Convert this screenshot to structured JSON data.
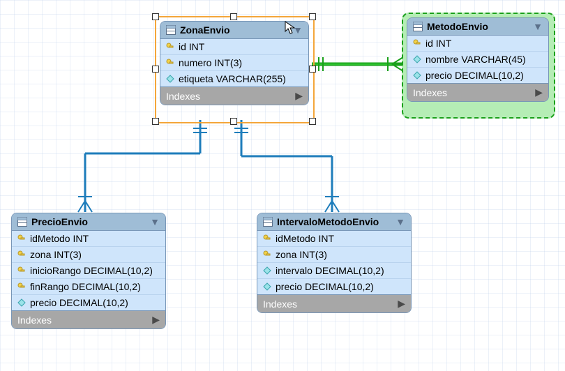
{
  "indexes_label": "Indexes",
  "entities": {
    "zonaEnvio": {
      "name": "ZonaEnvio",
      "cols": [
        {
          "text": "id INT",
          "icon": "key"
        },
        {
          "text": "numero INT(3)",
          "icon": "key"
        },
        {
          "text": "etiqueta VARCHAR(255)",
          "icon": "diamond"
        }
      ]
    },
    "metodoEnvio": {
      "name": "MetodoEnvio",
      "cols": [
        {
          "text": "id INT",
          "icon": "key"
        },
        {
          "text": "nombre VARCHAR(45)",
          "icon": "diamond"
        },
        {
          "text": "precio DECIMAL(10,2)",
          "icon": "diamond"
        }
      ]
    },
    "precioEnvio": {
      "name": "PrecioEnvio",
      "cols": [
        {
          "text": "idMetodo INT",
          "icon": "key"
        },
        {
          "text": "zona INT(3)",
          "icon": "key"
        },
        {
          "text": "inicioRango DECIMAL(10,2)",
          "icon": "key"
        },
        {
          "text": "finRango DECIMAL(10,2)",
          "icon": "key"
        },
        {
          "text": "precio DECIMAL(10,2)",
          "icon": "diamond"
        }
      ]
    },
    "intervaloMetodoEnvio": {
      "name": "IntervaloMetodoEnvio",
      "cols": [
        {
          "text": "idMetodo INT",
          "icon": "key"
        },
        {
          "text": "zona INT(3)",
          "icon": "key"
        },
        {
          "text": "intervalo DECIMAL(10,2)",
          "icon": "diamond"
        },
        {
          "text": "precio DECIMAL(10,2)",
          "icon": "diamond"
        }
      ]
    }
  },
  "chart_data": {
    "type": "table",
    "description": "Entity-Relationship diagram (MySQL Workbench style) with four tables and three relationships.",
    "tables": [
      {
        "name": "ZonaEnvio",
        "columns": [
          "id INT (PK)",
          "numero INT(3) (PK)",
          "etiqueta VARCHAR(255)"
        ]
      },
      {
        "name": "MetodoEnvio",
        "columns": [
          "id INT (PK)",
          "nombre VARCHAR(45)",
          "precio DECIMAL(10,2)"
        ]
      },
      {
        "name": "PrecioEnvio",
        "columns": [
          "idMetodo INT (PK)",
          "zona INT(3) (PK)",
          "inicioRango DECIMAL(10,2) (PK)",
          "finRango DECIMAL(10,2) (PK)",
          "precio DECIMAL(10,2)"
        ]
      },
      {
        "name": "IntervaloMetodoEnvio",
        "columns": [
          "idMetodo INT (PK)",
          "zona INT(3) (PK)",
          "intervalo DECIMAL(10,2)",
          "precio DECIMAL(10,2)"
        ]
      }
    ],
    "relationships": [
      {
        "from": "ZonaEnvio",
        "to": "MetodoEnvio",
        "type": "one-to-many",
        "selected": true
      },
      {
        "from": "ZonaEnvio",
        "to": "PrecioEnvio",
        "type": "one-to-many"
      },
      {
        "from": "ZonaEnvio",
        "to": "IntervaloMetodoEnvio",
        "type": "one-to-many"
      }
    ]
  }
}
